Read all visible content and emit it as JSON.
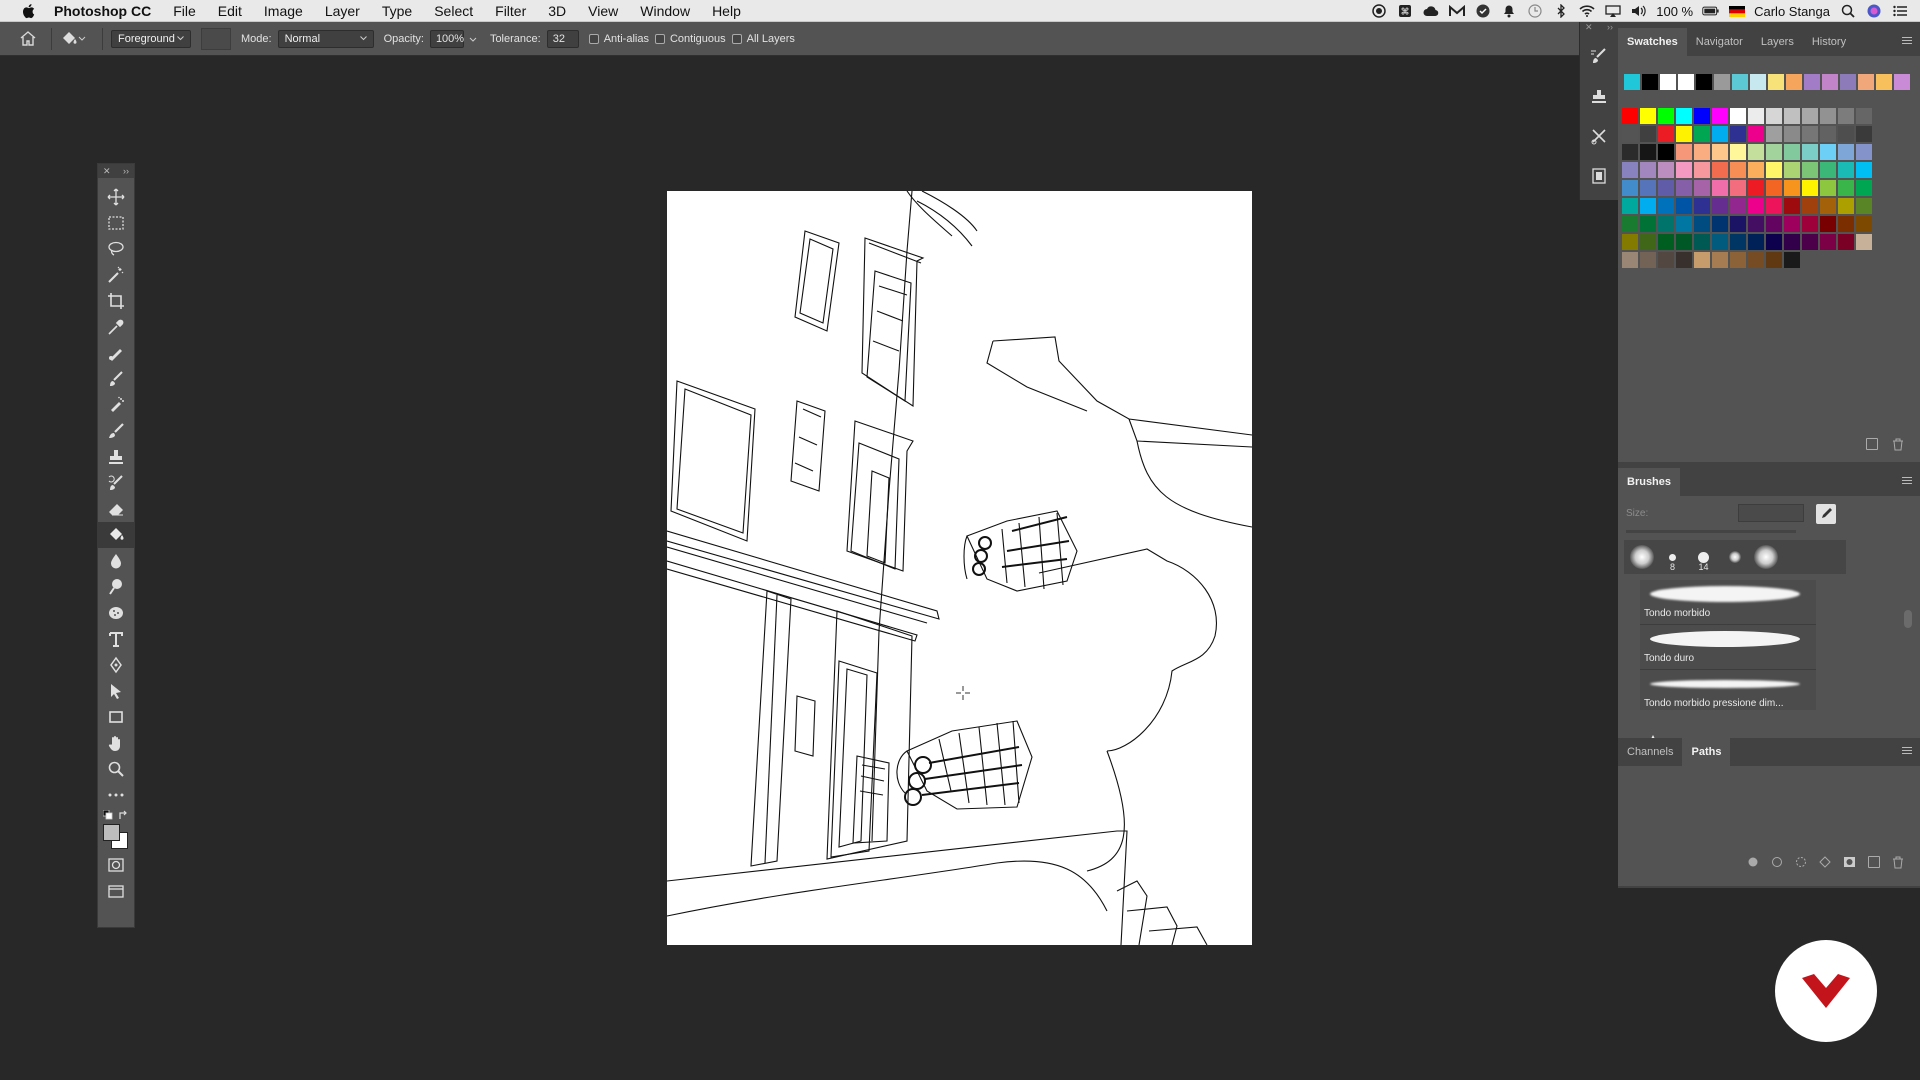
{
  "menubar": {
    "app_name": "Photoshop CC",
    "items": [
      "File",
      "Edit",
      "Image",
      "Layer",
      "Type",
      "Select",
      "Filter",
      "3D",
      "View",
      "Window",
      "Help"
    ],
    "battery": "100 %",
    "user": "Carlo Stanga"
  },
  "options_bar": {
    "fill_source": "Foreground",
    "mode_label": "Mode:",
    "mode_value": "Normal",
    "opacity_label": "Opacity:",
    "opacity_value": "100%",
    "tolerance_label": "Tolerance:",
    "tolerance_value": "32",
    "anti_alias": "Anti-alias",
    "contiguous": "Contiguous",
    "all_layers": "All Layers"
  },
  "toolbar": {
    "active_tool": "paint-bucket",
    "foreground_color": "#bdbdbd",
    "background_color": "#ffffff"
  },
  "panels": {
    "swatches_tabs": [
      "Swatches",
      "Navigator",
      "Layers",
      "History"
    ],
    "swatches_active": "Swatches",
    "brushes_title": "Brushes",
    "brush_size_label": "Size:",
    "brush_preset_sizes": [
      "8",
      "14"
    ],
    "brush_items": [
      "Tondo morbido",
      "Tondo duro",
      "Tondo morbido pressione dim..."
    ],
    "bottom_tabs": [
      "Channels",
      "Paths"
    ],
    "bottom_active": "Paths"
  },
  "swatches": {
    "recent": [
      "#20c7d8",
      "#000000",
      "#ffffff",
      "#ffffff",
      "#000000",
      "#9a9a9a",
      "#5bc8d4",
      "#c8e8f0",
      "#f7e27a",
      "#f5a55c",
      "#a27cc6",
      "#c284c8",
      "#8c7bb8",
      "#f0a87a",
      "#f7c05c",
      "#c98ad6"
    ],
    "grid": [
      "#ff0000",
      "#ffff00",
      "#00ff00",
      "#00ffff",
      "#0000ff",
      "#ff00ff",
      "#ffffff",
      "#ececec",
      "#d6d6d6",
      "#c0c0c0",
      "#a8a8a8",
      "#929292",
      "#7c7c7c",
      "#666666",
      "#545454",
      "#404040",
      "#ec1c24",
      "#fff200",
      "#00a651",
      "#00aeef",
      "#2e3192",
      "#ec008c",
      "#9f9f9f",
      "#8a8a8a",
      "#767676",
      "#626262",
      "#4e4e4e",
      "#3a3a3a",
      "#2b2b2b",
      "#161616",
      "#000000",
      "#f7977a",
      "#f9ad81",
      "#fdc68a",
      "#fff79a",
      "#c4df9b",
      "#a2d39c",
      "#82ca9d",
      "#7bcdc8",
      "#6ecff6",
      "#7ea7d8",
      "#8493ca",
      "#8882be",
      "#a187be",
      "#bc8dbf",
      "#f49ac2",
      "#f6989d",
      "#f26c4f",
      "#f68e56",
      "#fbaf5d",
      "#fff568",
      "#acd373",
      "#7cc576",
      "#3bb878",
      "#1abbb4",
      "#00bff3",
      "#438ccb",
      "#5574b9",
      "#605ca8",
      "#855fa8",
      "#a763a8",
      "#f06ea9",
      "#f26d7d",
      "#ed1c24",
      "#f26522",
      "#f7941d",
      "#fff200",
      "#8dc63f",
      "#39b54a",
      "#00a651",
      "#00a99d",
      "#00aeef",
      "#0072bc",
      "#0054a6",
      "#2e3192",
      "#662d91",
      "#92278f",
      "#ec008c",
      "#ed145b",
      "#9e0b0f",
      "#a0410d",
      "#a36209",
      "#aba000",
      "#598527",
      "#197b30",
      "#007236",
      "#00746b",
      "#0076a3",
      "#004b80",
      "#003471",
      "#1b1464",
      "#440e62",
      "#630460",
      "#9e005d",
      "#9e0039",
      "#790000",
      "#7b2e00",
      "#7d4900",
      "#827b00",
      "#406618",
      "#005e20",
      "#005826",
      "#005952",
      "#005b7f",
      "#003663",
      "#002157",
      "#0d004c",
      "#32004b",
      "#4b0049",
      "#7b0046",
      "#7a0026",
      "#c7b299",
      "#998675",
      "#736357",
      "#534741",
      "#37302d",
      "#c69c6d",
      "#a67c52",
      "#8c6239",
      "#754c24",
      "#603913",
      "#1a1a1a"
    ]
  },
  "icons": {
    "active_tool_bg": "#3a3a3a",
    "logo_color": "#c4141b"
  }
}
